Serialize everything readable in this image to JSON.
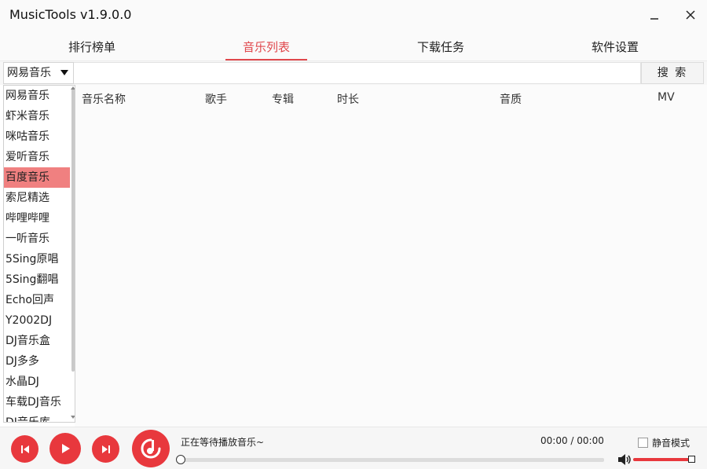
{
  "window": {
    "title": "MusicTools v1.9.0.0",
    "minimize_icon": "minimize-icon",
    "close_icon": "close-icon"
  },
  "tabs": [
    {
      "label": "排行榜单"
    },
    {
      "label": "音乐列表",
      "active": true
    },
    {
      "label": "下载任务"
    },
    {
      "label": "软件设置"
    }
  ],
  "search": {
    "source_selected": "网易音乐",
    "query": "",
    "button_label": "搜 索"
  },
  "sources": [
    "网易音乐",
    "虾米音乐",
    "咪咕音乐",
    "爱听音乐",
    "百度音乐",
    "索尼精选",
    "哔哩哔哩",
    "一听音乐",
    "5Sing原唱",
    "5Sing翻唱",
    "Echo回声",
    "Y2002DJ",
    "DJ音乐盒",
    "DJ多多",
    "水晶DJ",
    "车载DJ音乐",
    "DJ音乐库"
  ],
  "highlighted_source": "百度音乐",
  "table": {
    "columns": [
      "音乐名称",
      "歌手",
      "专辑",
      "时长",
      "音质",
      "MV"
    ]
  },
  "player": {
    "status": "正在等待播放音乐~",
    "time": "00:00 / 00:00",
    "progress": 0,
    "volume": 1.0,
    "mute_label": "静音模式",
    "muted": false
  },
  "colors": {
    "accent": "#e8383d",
    "highlight": "#f08080"
  }
}
